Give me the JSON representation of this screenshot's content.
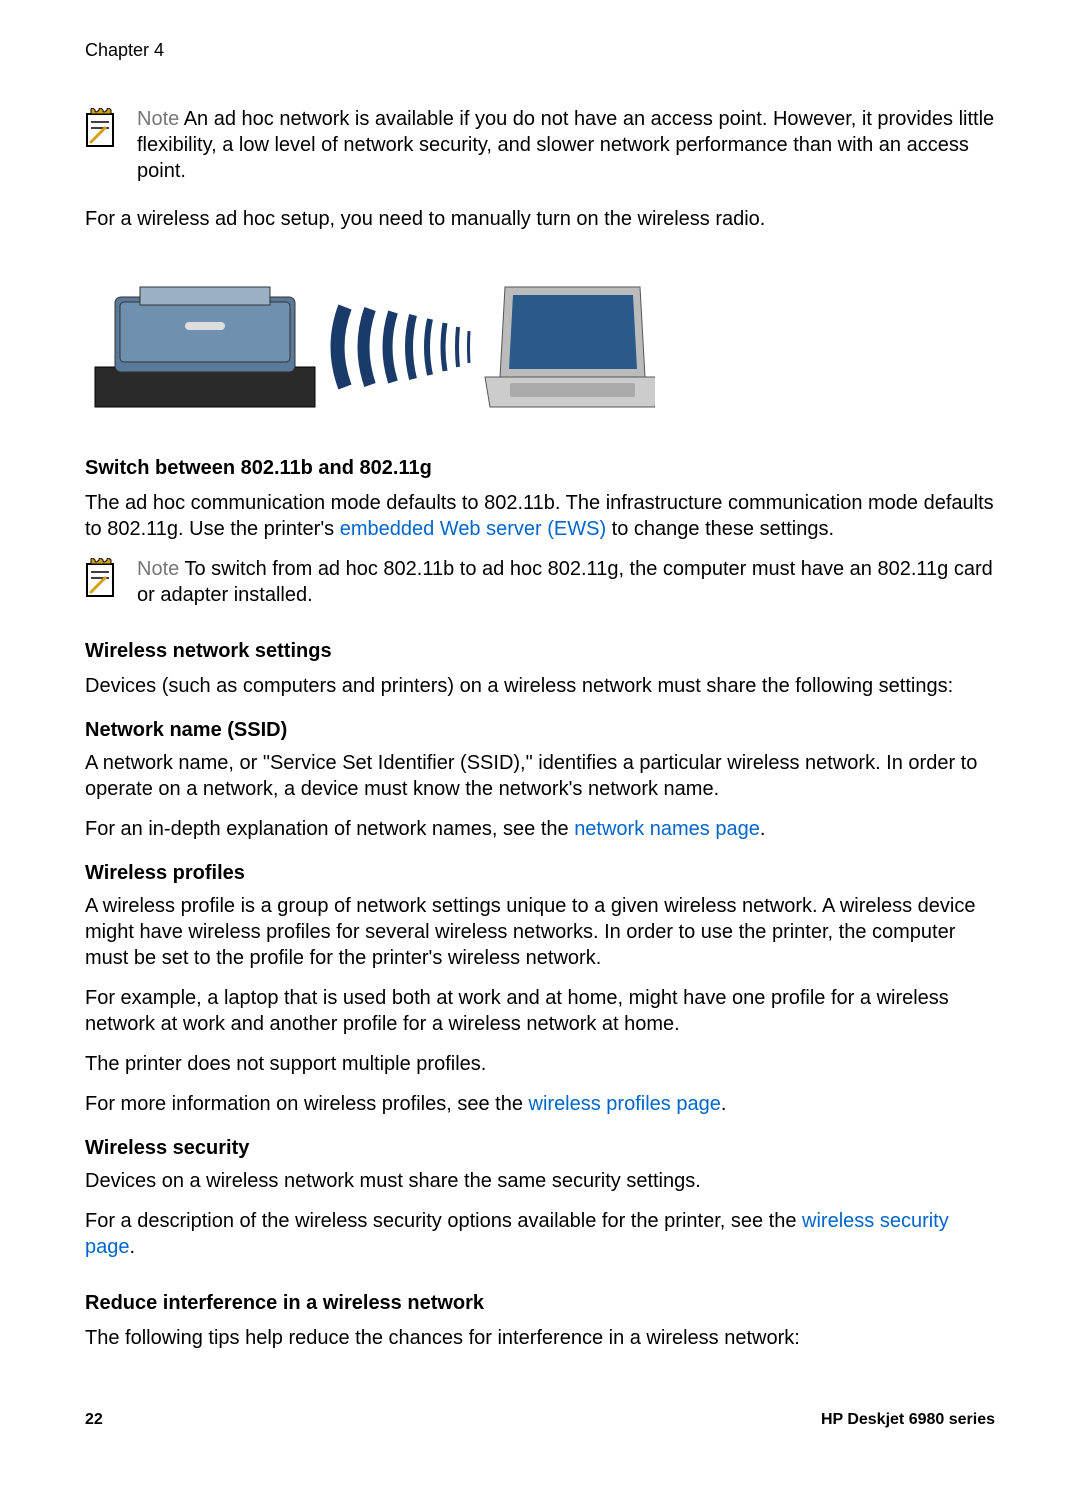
{
  "header": {
    "chapter": "Chapter 4"
  },
  "note1": {
    "label": "Note",
    "text": "An ad hoc network is available if you do not have an access point. However, it provides little flexibility, a low level of network security, and slower network performance than with an access point."
  },
  "para1": "For a wireless ad hoc setup, you need to manually turn on the wireless radio.",
  "switch": {
    "heading": "Switch between 802.11b and 802.11g",
    "p1a": "The ad hoc communication mode defaults to 802.11b. The infrastructure communication mode defaults to 802.11g. Use the printer's ",
    "link": "embedded Web server (EWS)",
    "p1b": " to change these settings."
  },
  "note2": {
    "label": "Note",
    "text": "To switch from ad hoc 802.11b to ad hoc 802.11g, the computer must have an 802.11g card or adapter installed."
  },
  "wireless_settings": {
    "heading": "Wireless network settings",
    "p1": "Devices (such as computers and printers) on a wireless network must share the following settings:"
  },
  "ssid": {
    "heading": "Network name (SSID)",
    "p1": "A network name, or \"Service Set Identifier (SSID),\" identifies a particular wireless network. In order to operate on a network, a device must know the network's network name.",
    "p2a": "For an in-depth explanation of network names, see the ",
    "link": "network names page",
    "p2b": "."
  },
  "profiles": {
    "heading": "Wireless profiles",
    "p1": "A wireless profile is a group of network settings unique to a given wireless network. A wireless device might have wireless profiles for several wireless networks. In order to use the printer, the computer must be set to the profile for the printer's wireless network.",
    "p2": "For example, a laptop that is used both at work and at home, might have one profile for a wireless network at work and another profile for a wireless network at home.",
    "p3": "The printer does not support multiple profiles.",
    "p4a": "For more information on wireless profiles, see the ",
    "link": "wireless profiles page",
    "p4b": "."
  },
  "security": {
    "heading": "Wireless security",
    "p1": "Devices on a wireless network must share the same security settings.",
    "p2a": "For a description of the wireless security options available for the printer, see the ",
    "link": "wireless security page",
    "p2b": "."
  },
  "interference": {
    "heading": "Reduce interference in a wireless network",
    "p1": "The following tips help reduce the chances for interference in a wireless network:"
  },
  "footer": {
    "page": "22",
    "product": "HP Deskjet 6980 series"
  }
}
